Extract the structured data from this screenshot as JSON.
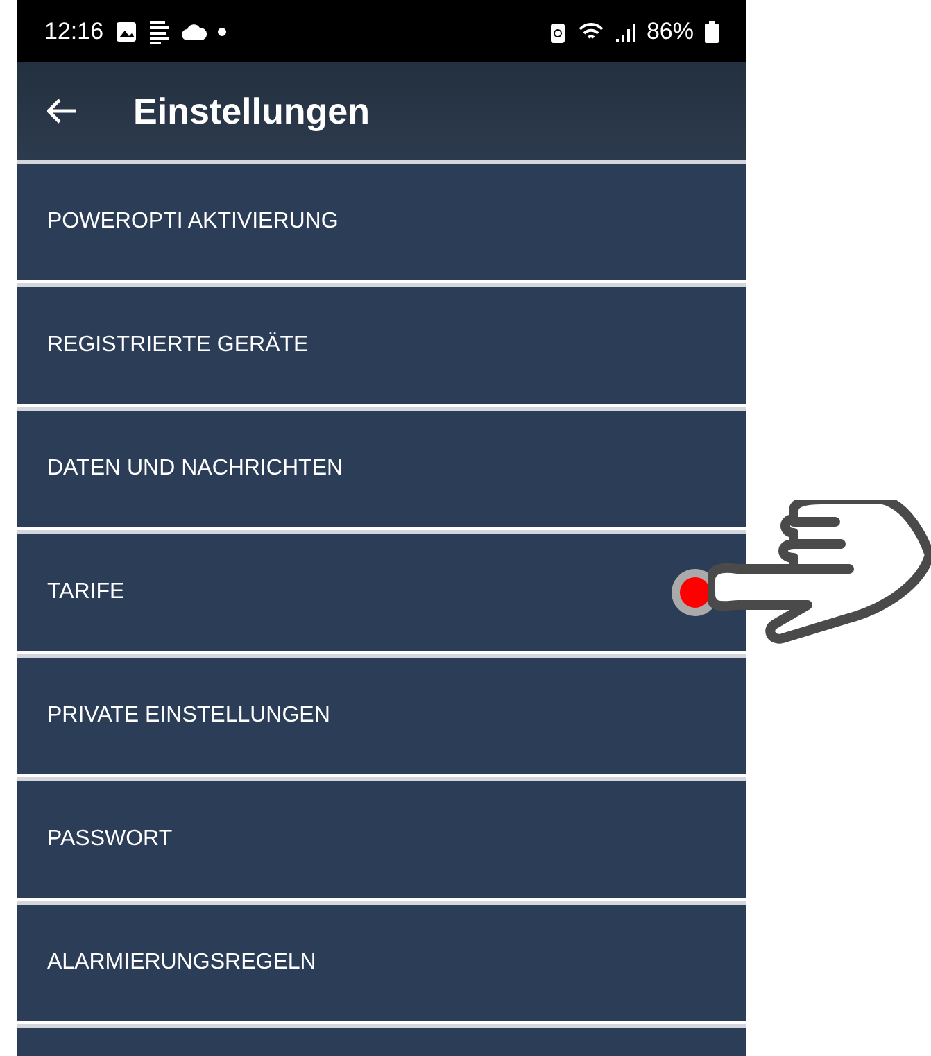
{
  "status_bar": {
    "time": "12:16",
    "battery": "86%"
  },
  "app_bar": {
    "title": "Einstellungen"
  },
  "items": [
    {
      "label": "POWEROPTI AKTIVIERUNG",
      "pointed": false
    },
    {
      "label": "REGISTRIERTE GERÄTE",
      "pointed": false
    },
    {
      "label": "DATEN UND NACHRICHTEN",
      "pointed": false
    },
    {
      "label": "TARIFE",
      "pointed": true
    },
    {
      "label": "PRIVATE EINSTELLUNGEN",
      "pointed": false
    },
    {
      "label": "PASSWORT",
      "pointed": false
    },
    {
      "label": "ALARMIERUNGSREGELN",
      "pointed": false
    },
    {
      "pointed": false
    }
  ]
}
